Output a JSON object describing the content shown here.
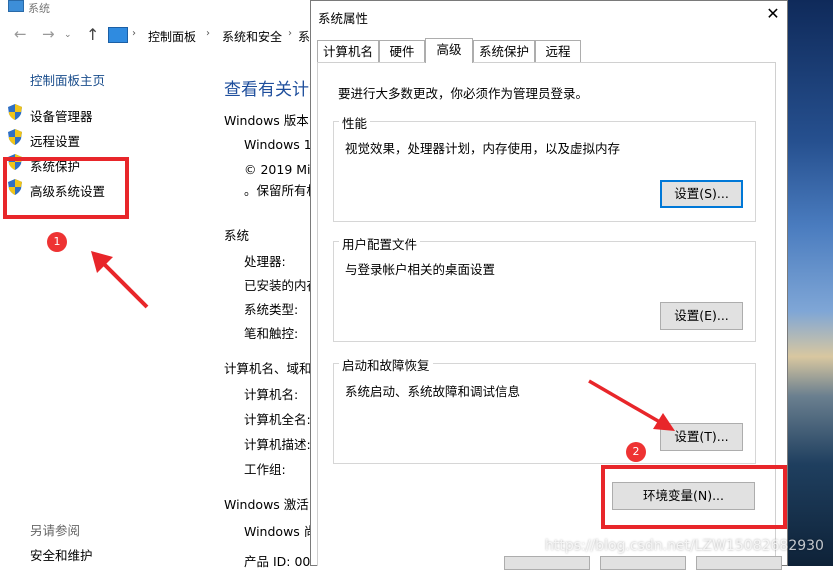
{
  "system_window": {
    "title": "系统",
    "breadcrumb": [
      "控制面板",
      "系统和安全",
      "系"
    ],
    "sidebar": {
      "home": "控制面板主页",
      "items": [
        {
          "label": "设备管理器"
        },
        {
          "label": "远程设置"
        },
        {
          "label": "系统保护"
        },
        {
          "label": "高级系统设置"
        }
      ],
      "see_also_title": "另请参阅",
      "see_also_item": "安全和维护"
    },
    "main": {
      "heading": "查看有关计算",
      "windows_edition_label": "Windows 版本",
      "windows_name": "Windows 1",
      "copyright": "© 2019 Mi",
      "rights": "。保留所有权",
      "system_section": "系统",
      "processor": "处理器:",
      "installed_ram": "已安装的内存",
      "system_type": "系统类型:",
      "pen_touch": "笔和触控:",
      "computer_name_section": "计算机名、域和",
      "computer_name": "计算机名:",
      "full_computer_name": "计算机全名:",
      "computer_description": "计算机描述:",
      "workgroup": "工作组:",
      "activation_section": "Windows 激活",
      "activation_status": "Windows 尚",
      "product_id": "产品 ID: 00"
    }
  },
  "dialog": {
    "title": "系统属性",
    "close_glyph": "✕",
    "tabs": [
      "计算机名",
      "硬件",
      "高级",
      "系统保护",
      "远程"
    ],
    "active_tab": "高级",
    "admin_note": "要进行大多数更改，你必须作为管理员登录。",
    "performance": {
      "label": "性能",
      "desc": "视觉效果，处理器计划，内存使用，以及虚拟内存",
      "button": "设置(S)..."
    },
    "user_profiles": {
      "label": "用户配置文件",
      "desc": "与登录帐户相关的桌面设置",
      "button": "设置(E)..."
    },
    "startup_recovery": {
      "label": "启动和故障恢复",
      "desc": "系统启动、系统故障和调试信息",
      "button": "设置(T)..."
    },
    "env_button": "环境变量(N)..."
  },
  "annotations": {
    "badge1": "1",
    "badge2": "2",
    "color": "#e8262a"
  },
  "watermark": "https://blog.csdn.net/LZW15082682930"
}
